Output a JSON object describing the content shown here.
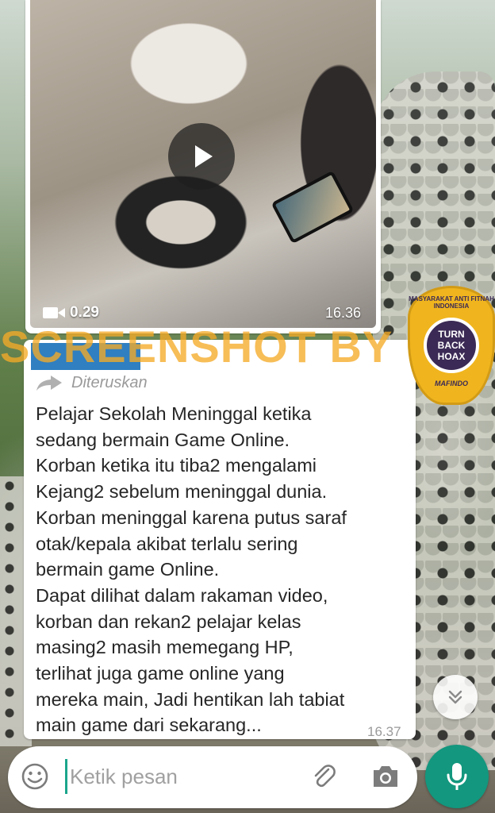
{
  "video_message": {
    "duration": "0.29",
    "time": "16.36"
  },
  "text_message": {
    "forwarded_label": "Diteruskan",
    "body": "Pelajar Sekolah Meninggal ketika\nsedang bermain Game Online.\nKorban ketika itu tiba2 mengalami\nKejang2 sebelum meninggal dunia.\nKorban meninggal karena putus saraf\notak/kepala akibat terlalu sering\nbermain game Online.\nDapat dilihat dalam rakaman video,\nkorban dan rekan2 pelajar kelas\nmasing2 masih memegang HP,\nterlihat juga game online yang\nmereka main, Jadi hentikan lah tabiat\nmain game dari sekarang...",
    "time": "16.37"
  },
  "watermark": {
    "text": "SCREENSHOT BY",
    "badge_line1": "TURN",
    "badge_line2": "BACK",
    "badge_line3": "HOAX",
    "badge_top": "MASYARAKAT ANTI FITNAH INDONESIA",
    "badge_bottom": "MAFINDO"
  },
  "composer": {
    "placeholder": "Ketik pesan"
  },
  "colors": {
    "accent": "#13977e",
    "bubble": "#ffffff",
    "watermark": "#f5aa28"
  }
}
